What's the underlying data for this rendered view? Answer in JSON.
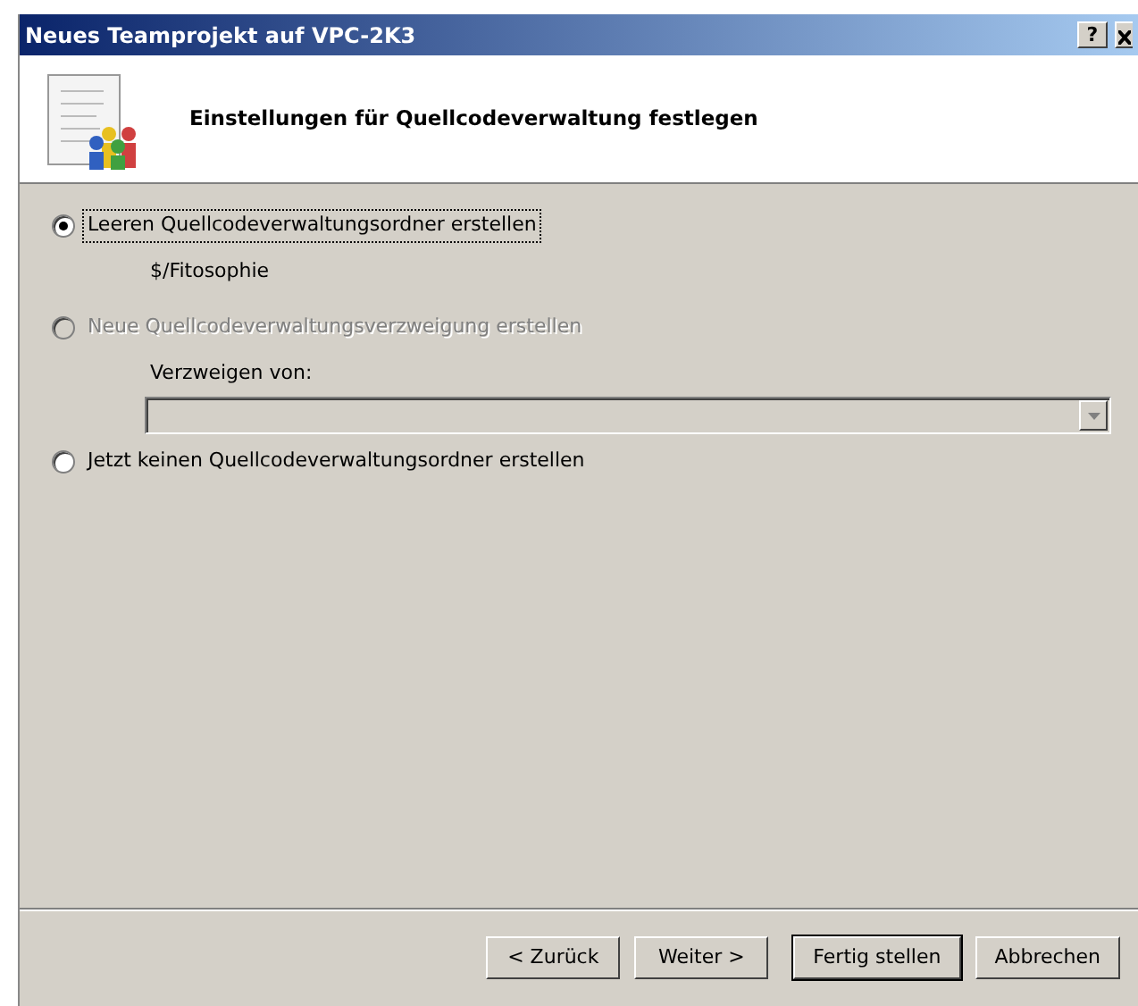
{
  "window": {
    "title": "Neues Teamprojekt auf VPC-2K3",
    "help_button": "?"
  },
  "header": {
    "title": "Einstellungen für Quellcodeverwaltung festlegen"
  },
  "options": [
    {
      "kind": "radio",
      "label": "Leeren Quellcodeverwaltungsordner erstellen",
      "selected": true,
      "disabled": false,
      "focused": true,
      "detail": "$/Fitosophie"
    },
    {
      "kind": "radio",
      "label": "Neue Quellcodeverwaltungsverzweigung erstellen",
      "selected": false,
      "disabled": true,
      "focused": false,
      "sub_label": "Verzweigen von:",
      "combo_disabled": true
    },
    {
      "kind": "radio",
      "label": "Jetzt keinen Quellcodeverwaltungsordner erstellen",
      "selected": false,
      "disabled": false,
      "focused": false
    }
  ],
  "buttons": [
    {
      "label": "< Zurück",
      "default": false
    },
    {
      "label": "Weiter >",
      "default": false
    },
    {
      "label": "Fertig stellen",
      "default": true
    },
    {
      "label": "Abbrechen",
      "default": false
    }
  ]
}
